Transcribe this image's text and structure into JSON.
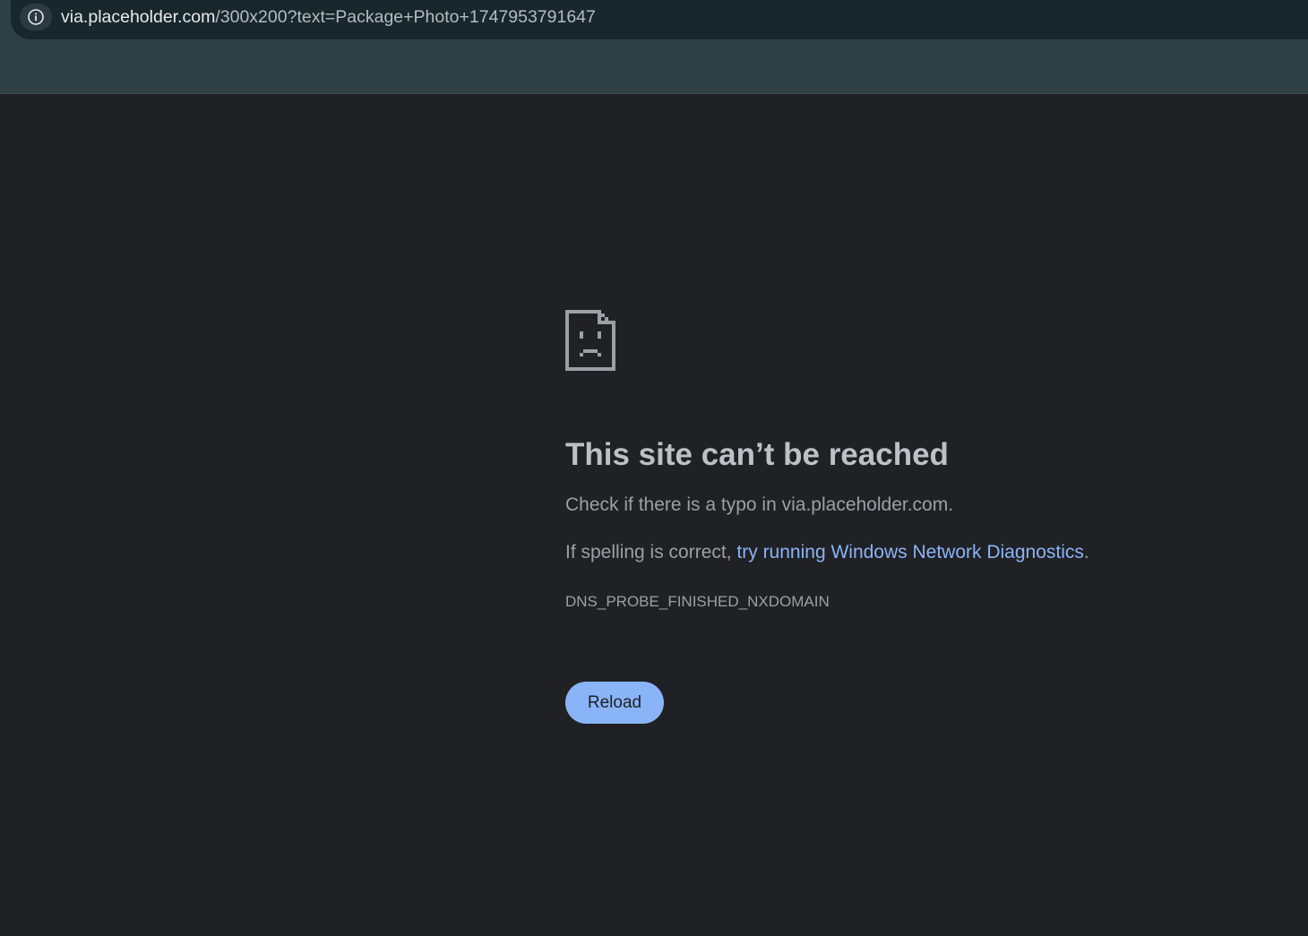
{
  "address_bar": {
    "url_host": "via.placeholder.com",
    "url_path": "/300x200?text=Package+Photo+1747953791647",
    "site_info_icon": "info-icon"
  },
  "error_page": {
    "icon": "sad-page-icon",
    "title": "This site can’t be reached",
    "typo_message": "Check if there is a typo in via.placeholder.com.",
    "spelling_prefix": "If spelling is correct, ",
    "diagnostics_link": "try running Windows Network Diagnostics",
    "spelling_suffix": ".",
    "error_code": "DNS_PROBE_FINISHED_NXDOMAIN",
    "reload_label": "Reload"
  },
  "colors": {
    "page_background": "#202124",
    "toolbar": "#2f4045",
    "omnibox": "#17272b",
    "link": "#8ab4f8",
    "button": "#8ab4f8"
  }
}
